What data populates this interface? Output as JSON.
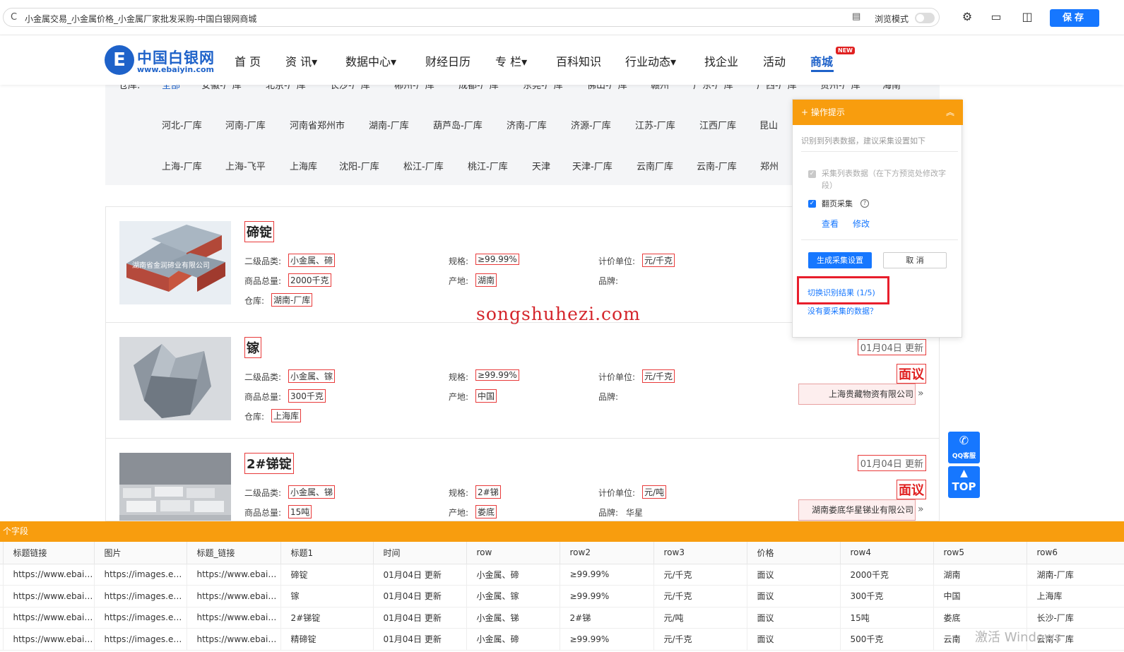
{
  "browser": {
    "url_text": "小金属交易_小金属价格_小金属厂家批发采购-中国白银网商城",
    "browse_mode_label": "浏览模式",
    "save_label": "保存"
  },
  "site": {
    "logo_cn": "中国白银网",
    "logo_en": "www.ebaiyin.com",
    "logo_mark": "E",
    "nav": [
      "首 页",
      "资 讯▾",
      "数据中心▾",
      "财经日历",
      "专 栏▾",
      "百科知识",
      "行业动态▾",
      "找企业",
      "活动",
      "商城"
    ],
    "new_badge": "NEW"
  },
  "filter": {
    "row0_partial": [
      "仓库:",
      "全部",
      "安徽-厂库",
      "北京-厂库",
      "长沙-厂库",
      "郴州-厂库",
      "成都-厂库",
      "东莞-厂库",
      "佛山-厂库",
      "赣州",
      "广东-厂库",
      "广西-厂库",
      "贵州-厂库",
      "海南"
    ],
    "row1": [
      "河北-厂库",
      "河南-厂库",
      "河南省郑州市",
      "湖南-厂库",
      "葫芦岛-厂库",
      "济南-厂库",
      "济源-厂库",
      "江苏-厂库",
      "江西厂库",
      "昆山"
    ],
    "row2": [
      "上海-厂库",
      "上海-飞平",
      "上海库",
      "沈阳-厂库",
      "松江-厂库",
      "桃江-厂库",
      "天津",
      "天津-厂库",
      "云南厂库",
      "云南-厂库",
      "郑州"
    ]
  },
  "labels": {
    "category": "二级品类:",
    "spec": "规格:",
    "unit": "计价单位:",
    "total": "商品总量:",
    "origin": "产地:",
    "brand": "品牌:",
    "warehouse": "仓库:"
  },
  "products": [
    {
      "title": "碲锭",
      "img_caption": "湖南省金润碲业有限公司",
      "category": "小金属、碲",
      "spec": "≥99.99%",
      "unit": "元/千克",
      "total": "2000千克",
      "origin": "湖南",
      "brand": "",
      "warehouse": "湖南-厂库",
      "date": "",
      "price": "",
      "company": ""
    },
    {
      "title": "镓",
      "img_caption": "",
      "category": "小金属、镓",
      "spec": "≥99.99%",
      "unit": "元/千克",
      "total": "300千克",
      "origin": "中国",
      "brand": "",
      "warehouse": "上海库",
      "date": "01月04日 更新",
      "price": "面议",
      "company": "上海贵藏物资有限公司"
    },
    {
      "title": "2#锑锭",
      "img_caption": "",
      "category": "小金属、锑",
      "spec": "2#锑",
      "unit": "元/吨",
      "total": "15吨",
      "origin": "娄底",
      "brand": "华星",
      "warehouse": "",
      "date": "01月04日 更新",
      "price": "面议",
      "company": "湖南娄底华星锑业有限公司"
    }
  ],
  "watermark": "songshuhezi.com",
  "tips": {
    "title": "操作提示",
    "desc": "识别到列表数据，建议采集设置如下",
    "option1": "采集列表数据（在下方预览处修改字段）",
    "option2": "翻页采集",
    "view": "查看",
    "edit": "修改",
    "generate": "生成采集设置",
    "cancel": "取 消",
    "switch": "切换识别结果 (1/5)",
    "nodata": "没有要采集的数据？"
  },
  "side": {
    "qq_label": "QQ客服",
    "top_label": "TOP"
  },
  "panel": {
    "header": "个字段",
    "columns": [
      "标题链接",
      "图片",
      "标题_链接",
      "标题1",
      "时间",
      "row",
      "row2",
      "row3",
      "价格",
      "row4",
      "row5",
      "row6"
    ],
    "rows": [
      [
        "https://www.ebaiyi...",
        "https://images.ebai...",
        "https://www.ebaiyi...",
        "碲锭",
        "01月04日 更新",
        "小金属、碲",
        "≥99.99%",
        "元/千克",
        "面议",
        "2000千克",
        "湖南",
        "湖南-厂库"
      ],
      [
        "https://www.ebaiyi...",
        "https://images.ebai...",
        "https://www.ebaiyi...",
        "镓",
        "01月04日 更新",
        "小金属、镓",
        "≥99.99%",
        "元/千克",
        "面议",
        "300千克",
        "中国",
        "上海库"
      ],
      [
        "https://www.ebaiyi...",
        "https://images.ebai...",
        "https://www.ebaiyi...",
        "2#锑锭",
        "01月04日 更新",
        "小金属、锑",
        "2#锑",
        "元/吨",
        "面议",
        "15吨",
        "娄底",
        "长沙-厂库"
      ],
      [
        "https://www.ebaiyi...",
        "https://images.ebai...",
        "https://www.ebaiyi...",
        "精碲锭",
        "01月04日 更新",
        "小金属、碲",
        "≥99.99%",
        "元/千克",
        "面议",
        "500千克",
        "云南",
        "云南-厂库"
      ]
    ]
  },
  "os_watermark": "激活 Windows"
}
